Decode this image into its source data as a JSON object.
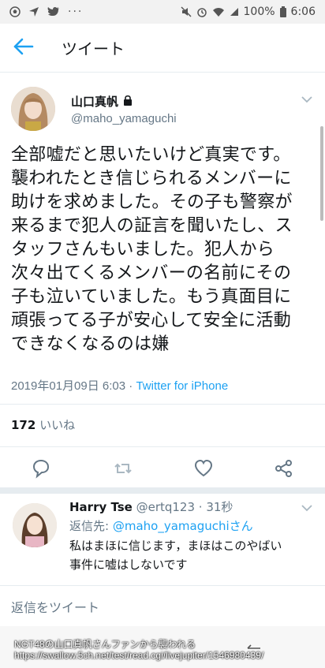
{
  "status_bar": {
    "battery": "100%",
    "time": "6:06",
    "left_icons": [
      "soccer-ball-icon",
      "location-icon",
      "twitter-icon",
      "more-icon"
    ],
    "right_icons": [
      "mute-icon",
      "alarm-icon",
      "wifi-icon",
      "signal-icon",
      "battery-icon"
    ]
  },
  "app_bar": {
    "title": "ツイート",
    "back_icon": "arrow-left-icon",
    "accent": "#1da1f2"
  },
  "tweet": {
    "display_name": "山口真帆",
    "handle": "@maho_yamaguchi",
    "locked": true,
    "lines": [
      "全部嘘だと思いたいけど真実です。",
      "襲われたとき信じられるメンバーに",
      "助けを求めました。その子も警察が",
      "来るまで犯人の証言を聞いたし、ス",
      "タッフさんもいました。犯人から",
      "次々出てくるメンバーの名前にその",
      "子も泣いていました。もう真面目に",
      "頑張ってる子が安心して安全に活動",
      "できなくなるのは嫌"
    ],
    "timestamp": "2019年01月09日 6:03 · ",
    "source": "Twitter for iPhone",
    "likes_count": "172",
    "likes_label": "いいね"
  },
  "reply": {
    "name": "Harry Tse",
    "handle_time": "@ertq123 · 31秒",
    "reply_prefix": "返信先: ",
    "reply_to": "@maho_yamaguchiさん",
    "text_lines": [
      "私はまほに信じます，まほはこのやばい",
      "事件に嘘はしないです"
    ]
  },
  "reply_bar": {
    "placeholder": "返信をツイート"
  },
  "watermark": {
    "line1": "NGT48の山口真帆さんファンから襲われる",
    "line2": "https://swallow.5ch.net/test/read.cgi/livejupiter/1546980439/"
  }
}
